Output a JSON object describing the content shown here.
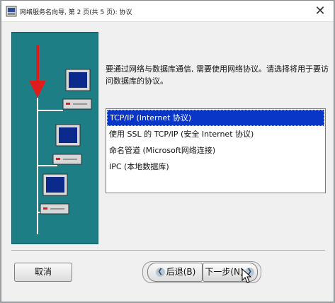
{
  "window": {
    "title": "网络服务名向导, 第 2 页(共 5 页): 协议",
    "close_glyph": "✕"
  },
  "prompt": "要通过网络与数据库通信, 需要使用网络协议。请选择将用于要访问数据库的协议。",
  "protocols": {
    "items": [
      "TCP/IP (Internet 协议)",
      "使用 SSL 的 TCP/IP (安全 Internet 协议)",
      "命名管道 (Microsoft网络连接)",
      "IPC (本地数据库)"
    ],
    "selected_index": 0
  },
  "buttons": {
    "cancel": "取消",
    "back": "后退(B)",
    "next": "下一步(N)"
  },
  "icons": {
    "back": "chevron-left-icon",
    "next": "chevron-right-icon",
    "close": "close-icon",
    "app": "wizard-app-icon"
  },
  "colors": {
    "illustration_bg": "#1d7e86",
    "selection_bg": "#0a36c8",
    "arrow": "#e01b1b"
  }
}
